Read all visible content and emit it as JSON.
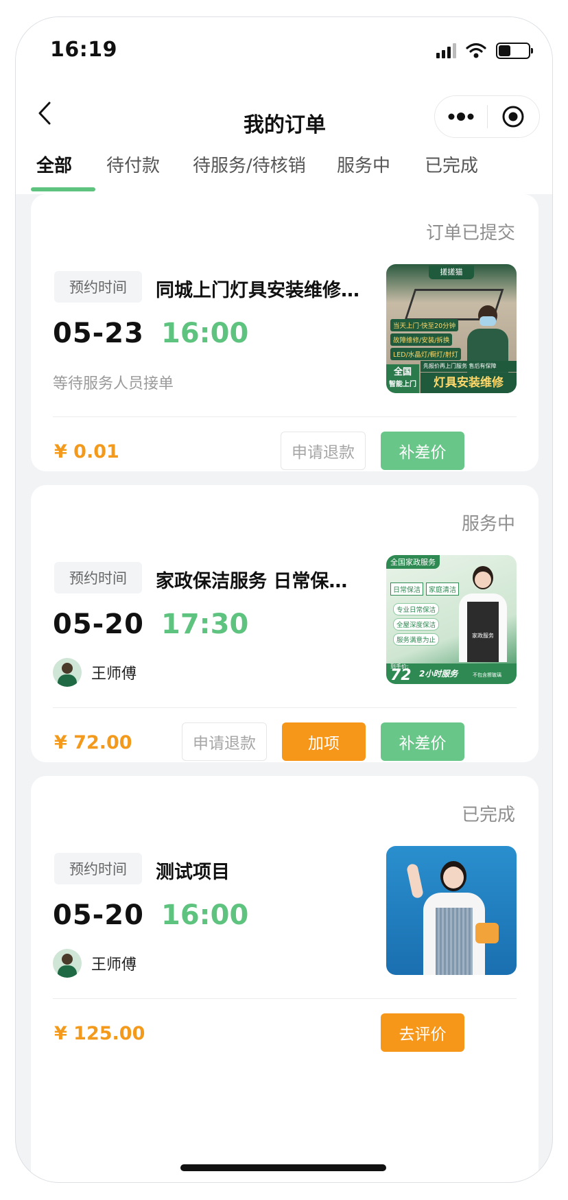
{
  "status_bar": {
    "time": "16:19"
  },
  "nav": {
    "title": "我的订单"
  },
  "tabs": [
    "全部",
    "待付款",
    "待服务/待核销",
    "服务中",
    "已完成"
  ],
  "orders": [
    {
      "status": "订单已提交",
      "tag": "预约时间",
      "title": "同城上门灯具安装维修上门服务",
      "date": "05-23",
      "time": "16:00",
      "note": "等待服务人员接单",
      "price": "¥ 0.01",
      "buttons": [
        "申请退款",
        "补差价"
      ],
      "thumb": {
        "brand": "搓搓猫",
        "lines": [
          "当天上门·快至20分钟",
          "故障维修/安装/拆换",
          "LED/水晶灯/橱灯/射灯"
        ],
        "tag": "全国",
        "tag2": "智能上门",
        "promise": "先报价再上门服务 售后有保障",
        "headline": "灯具安装维修"
      }
    },
    {
      "status": "服务中",
      "tag": "预约时间",
      "title": "家政保洁服务 日常保洁深度清洁",
      "date": "05-20",
      "time": "17:30",
      "worker": "王师傅",
      "price": "¥ 72.00",
      "buttons": [
        "申请退款",
        "加项",
        "补差价"
      ],
      "thumb": {
        "headline": "全国家政服务",
        "tags": [
          "日常保洁",
          "家庭清洁"
        ],
        "items": [
          "专业日常保洁",
          "全屋深度保洁",
          "服务满意为止"
        ],
        "price_label": "到手价:",
        "price": "72",
        "duration": "2小时服务",
        "note": "不包含擦玻璃",
        "apron": "家政服务"
      }
    },
    {
      "status": "已完成",
      "tag": "预约时间",
      "title": "测试项目",
      "date": "05-20",
      "time": "16:00",
      "worker": "王师傅",
      "price": "¥ 125.00",
      "buttons": [
        "去评价"
      ]
    }
  ],
  "colors": {
    "accent_green": "#5ec37f",
    "accent_orange": "#f7971a",
    "price_orange": "#f39a1c",
    "page_bg": "#f1f3f5"
  }
}
